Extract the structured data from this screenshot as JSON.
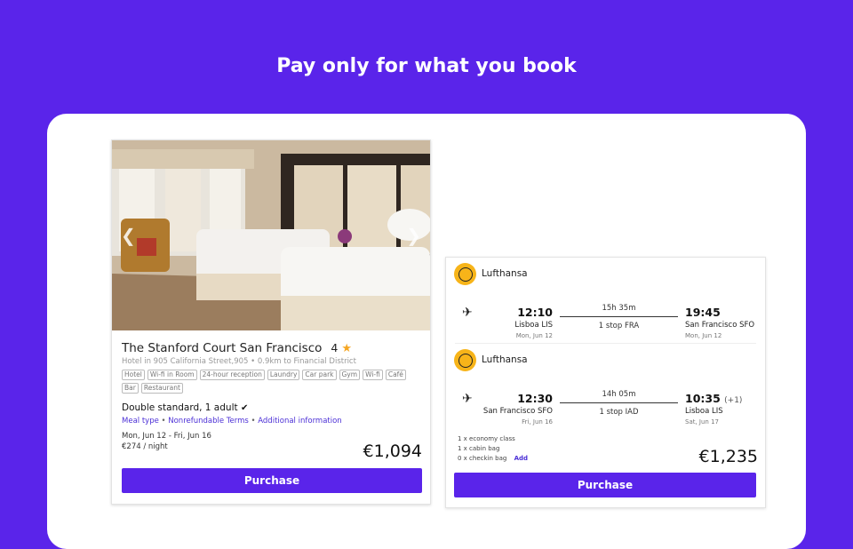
{
  "header": {
    "title": "Pay only for what you book"
  },
  "hotel": {
    "name": "The Stanford Court San Francisco",
    "rating": "4",
    "address": "Hotel in 905 California Street,905 • 0.9km to Financial District",
    "amenities": [
      "Hotel",
      "Wi-fi in Room",
      "24-hour reception",
      "Laundry",
      "Car park",
      "Gym",
      "Wi-fi",
      "Café",
      "Bar",
      "Restaurant"
    ],
    "room": "Double standard, 1 adult",
    "meal_type": "Meal type",
    "terms": "Nonrefundable Terms",
    "additional_info": "Additional information",
    "link_sep": "•",
    "dates": "Mon, Jun 12 - Fri, Jun 16",
    "per_night": "€274 / night",
    "price": "€1,094",
    "purchase_label": "Purchase"
  },
  "flight": {
    "segments": [
      {
        "airline": "Lufthansa",
        "dep_time": "12:10",
        "dep_place": "Lisboa LIS",
        "dep_date": "Mon, Jun 12",
        "duration": "15h 35m",
        "stops": "1 stop FRA",
        "arr_time": "19:45",
        "arr_extra": "",
        "arr_place": "San Francisco SFO",
        "arr_date": "Mon, Jun 12"
      },
      {
        "airline": "Lufthansa",
        "dep_time": "12:30",
        "dep_place": "San Francisco SFO",
        "dep_date": "Fri, Jun 16",
        "duration": "14h 05m",
        "stops": "1 stop IAD",
        "arr_time": "10:35",
        "arr_extra": "(+1)",
        "arr_place": "Lisboa LIS",
        "arr_date": "Sat, Jun 17"
      }
    ],
    "bags": [
      "1 x economy class",
      "1 x cabin bag",
      "0 x checkin bag"
    ],
    "add_label": "Add",
    "price": "€1,235",
    "purchase_label": "Purchase"
  },
  "colors": {
    "accent": "#5a24ea",
    "star": "#f5a623",
    "lufthansa": "#f7b419",
    "link": "#4b2fd6"
  },
  "icons": {
    "star": "star-icon",
    "plane": "plane-icon",
    "prev": "chevron-left-icon",
    "next": "chevron-right-icon",
    "check": "check-icon"
  }
}
